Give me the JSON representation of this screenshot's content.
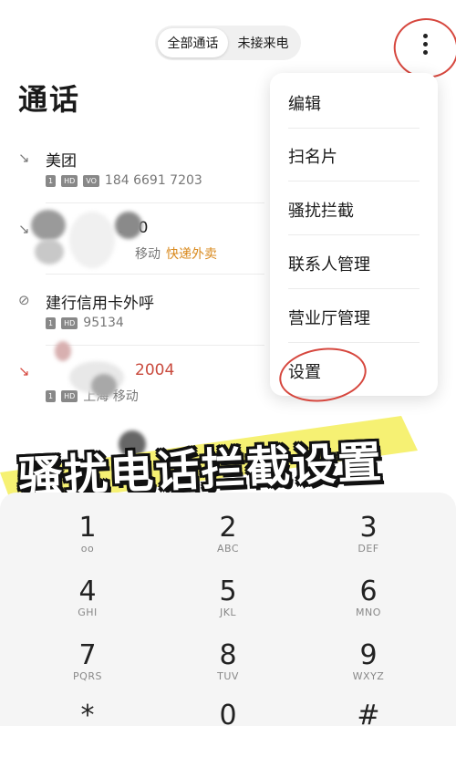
{
  "tabs": [
    {
      "label": "全部通话",
      "active": true
    },
    {
      "label": "未接来电",
      "active": false
    }
  ],
  "title": "通话",
  "calls": [
    {
      "name": "美团",
      "sim": "1",
      "hd": "HD",
      "vo": "VO",
      "number": "184 6691 7203",
      "type": "incoming"
    },
    {
      "name": "570",
      "location": "移动",
      "tag": "快递外卖",
      "sim": "1",
      "type": "incoming"
    },
    {
      "name": "建行信用卡外呼",
      "sim": "1",
      "hd": "HD",
      "number": "95134",
      "type": "blocked"
    },
    {
      "name": "2004",
      "sim": "1",
      "hd": "HD",
      "location": "上海 移动",
      "type": "missed"
    }
  ],
  "menu": {
    "items": [
      "编辑",
      "扫名片",
      "骚扰拦截",
      "联系人管理",
      "营业厅管理",
      "设置"
    ]
  },
  "banner": "骚扰电话拦截设置",
  "dialpad": [
    {
      "digit": "1",
      "letters": "oo"
    },
    {
      "digit": "2",
      "letters": "ABC"
    },
    {
      "digit": "3",
      "letters": "DEF"
    },
    {
      "digit": "4",
      "letters": "GHI"
    },
    {
      "digit": "5",
      "letters": "JKL"
    },
    {
      "digit": "6",
      "letters": "MNO"
    },
    {
      "digit": "7",
      "letters": "PQRS"
    },
    {
      "digit": "8",
      "letters": "TUV"
    },
    {
      "digit": "9",
      "letters": "WXYZ"
    },
    {
      "digit": "*",
      "letters": ""
    },
    {
      "digit": "0",
      "letters": ""
    },
    {
      "digit": "#",
      "letters": ""
    }
  ],
  "colors": {
    "accent_red": "#d6473e",
    "tag_orange": "#d98a1e",
    "highlight_yellow": "#f4ee5a"
  }
}
